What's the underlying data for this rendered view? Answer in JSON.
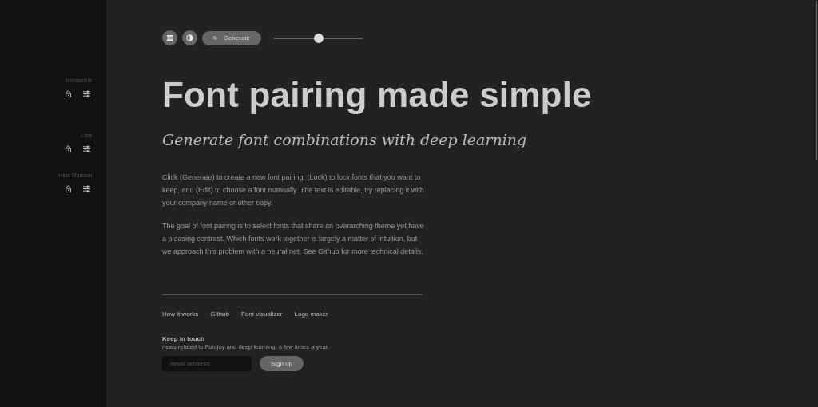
{
  "sidebar": {
    "fonts": [
      {
        "name": "Montserrat",
        "locked": false
      },
      {
        "name": "Lora",
        "locked": false
      },
      {
        "name": "Hind Madurai",
        "locked": false
      }
    ]
  },
  "toolbar": {
    "generate_label": "Generate",
    "slider": {
      "level": 0.5
    }
  },
  "title": "Font pairing made simple",
  "subtitle": "Generate font combinations with deep learning",
  "paragraphs": [
    "Click (Generate) to create a new font pairing, (Lock) to lock fonts that you want to keep, and (Edit) to choose a font manually. The text is editable, try replacing it with your company name or other copy.",
    "The goal of font pairing is to select fonts that share an overarching theme yet have a pleasing contrast. Which fonts work together is largely a matter of intuition, but we approach this problem with a neural net. See Github for more technical details."
  ],
  "footer_links": [
    "How it works",
    "Github",
    "Font visualizer",
    "Logo maker"
  ],
  "newsletter": {
    "heading": "Keep in touch",
    "description": "news related to Fontjoy and deep learning, a few times a year.",
    "email_placeholder": "email address",
    "button": "Sign up"
  }
}
